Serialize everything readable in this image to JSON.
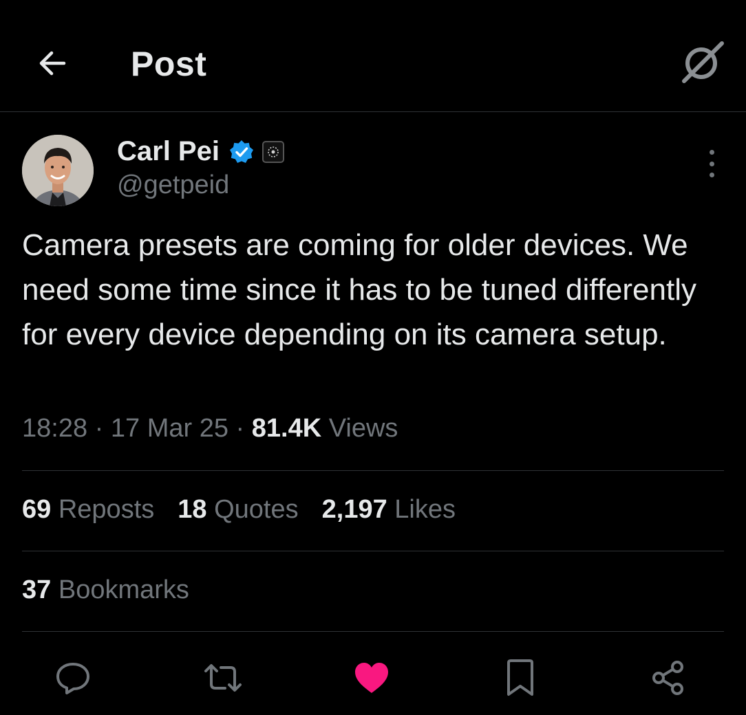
{
  "header": {
    "title": "Post",
    "back_icon": "arrow-left-icon",
    "grok_icon": "grok-icon"
  },
  "author": {
    "name": "Carl Pei",
    "handle": "@getpeid",
    "verified_color": "#1d9bf0"
  },
  "tweet": {
    "text": "Camera presets are coming for older devices. We need some time since it has to be tuned differently for every device depending on its camera setup.",
    "time": "18:28",
    "date": "17 Mar 25",
    "views_count": "81.4K",
    "views_label": "Views",
    "separator": "·"
  },
  "stats": {
    "reposts_count": "69",
    "reposts_label": "Reposts",
    "quotes_count": "18",
    "quotes_label": "Quotes",
    "likes_count": "2,197",
    "likes_label": "Likes",
    "bookmarks_count": "37",
    "bookmarks_label": "Bookmarks"
  },
  "actions": {
    "reply_icon": "reply-icon",
    "repost_icon": "repost-icon",
    "like_icon": "heart-icon",
    "like_color": "#f91880",
    "bookmark_icon": "bookmark-icon",
    "share_icon": "share-icon"
  },
  "colors": {
    "background": "#000000",
    "text_primary": "#e7e9ea",
    "text_secondary": "#71767b",
    "divider": "#2f3336"
  }
}
